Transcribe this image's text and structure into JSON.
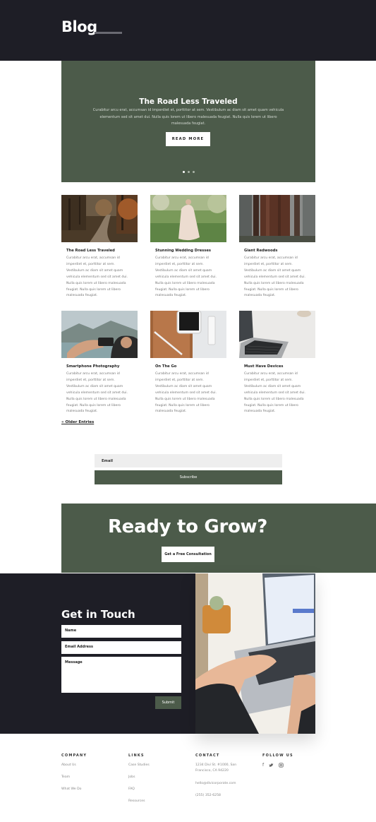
{
  "header": {
    "title": "Blog"
  },
  "hero": {
    "title": "The Road Less Traveled",
    "body": "Curabitur arcu erat, accumsan id imperdiet et, porttitor at sem. Vestibulum ac diam sit amet quam vehicula elementum sed sit amet dui. Nulla quis lorem ut libero malesuada feugiat. Nulla quis lorem ut libero malesuada feugiat.",
    "button": "READ MORE",
    "slides_total": 3,
    "active_slide": 1
  },
  "posts": [
    {
      "title": "The Road Less Traveled",
      "excerpt": "Curabitur arcu erat, accumsan id imperdiet et, porttitor at sem. Vestibulum ac diam sit amet quam vehicula elementum sed sit amet dui. Nulla quis lorem ut libero malesuada feugiat. Nulla quis lorem ut libero malesuada feugiat.",
      "image": "forest-road-photo"
    },
    {
      "title": "Stunning Wedding Dresses",
      "excerpt": "Curabitur arcu erat, accumsan id imperdiet et, porttitor at sem. Vestibulum ac diam sit amet quam vehicula elementum sed sit amet dui. Nulla quis lorem ut libero malesuada feugiat. Nulla quis lorem ut libero malesuada feugiat.",
      "image": "wedding-dress-photo"
    },
    {
      "title": "Giant Redwoods",
      "excerpt": "Curabitur arcu erat, accumsan id imperdiet et, porttitor at sem. Vestibulum ac diam sit amet quam vehicula elementum sed sit amet dui. Nulla quis lorem ut libero malesuada feugiat. Nulla quis lorem ut libero malesuada feugiat.",
      "image": "redwoods-photo"
    },
    {
      "title": "Smartphone Photography",
      "excerpt": "Curabitur arcu erat, accumsan id imperdiet et, porttitor at sem. Vestibulum ac diam sit amet quam vehicula elementum sed sit amet dui. Nulla quis lorem ut libero malesuada feugiat. Nulla quis lorem ut libero malesuada feugiat.",
      "image": "smartphone-photo"
    },
    {
      "title": "On The Go",
      "excerpt": "Curabitur arcu erat, accumsan id imperdiet et, porttitor at sem. Vestibulum ac diam sit amet quam vehicula elementum sed sit amet dui. Nulla quis lorem ut libero malesuada feugiat. Nulla quis lorem ut libero malesuada feugiat.",
      "image": "phone-wallet-photo"
    },
    {
      "title": "Must Have Devices",
      "excerpt": "Curabitur arcu erat, accumsan id imperdiet et, porttitor at sem. Vestibulum ac diam sit amet quam vehicula elementum sed sit amet dui. Nulla quis lorem ut libero malesuada feugiat. Nulla quis lorem ut libero malesuada feugiat.",
      "image": "laptop-photo"
    }
  ],
  "pagination": {
    "older": "« Older Entries"
  },
  "newsletter": {
    "email_placeholder": "Email",
    "button": "Subscribe"
  },
  "cta": {
    "title": "Ready to Grow?",
    "button": "Get a Free Consultation"
  },
  "contact": {
    "title": "Get in Touch",
    "name_placeholder": "Name",
    "email_placeholder": "Email Address",
    "message_placeholder": "Message",
    "submit": "Submit",
    "image": "laptop-hands-photo"
  },
  "footer": {
    "company": {
      "heading": "COMPANY",
      "items": [
        "About Us",
        "Team",
        "What We Do"
      ]
    },
    "links": {
      "heading": "LINKS",
      "items": [
        "Case Studies",
        "Jobs",
        "FAQ",
        "Resources"
      ]
    },
    "contact": {
      "heading": "CONTACT",
      "items": [
        "1234 Divi St. #1000, San Francisco, CA 94220",
        "hello@divicorporate.com",
        "(255) 352-6258"
      ]
    },
    "follow": {
      "heading": "FOLLOW US",
      "icons": [
        "facebook-icon",
        "twitter-icon",
        "instagram-icon"
      ]
    }
  },
  "colors": {
    "dark": "#1e1e26",
    "accent": "#4c5b4a",
    "white": "#ffffff"
  }
}
